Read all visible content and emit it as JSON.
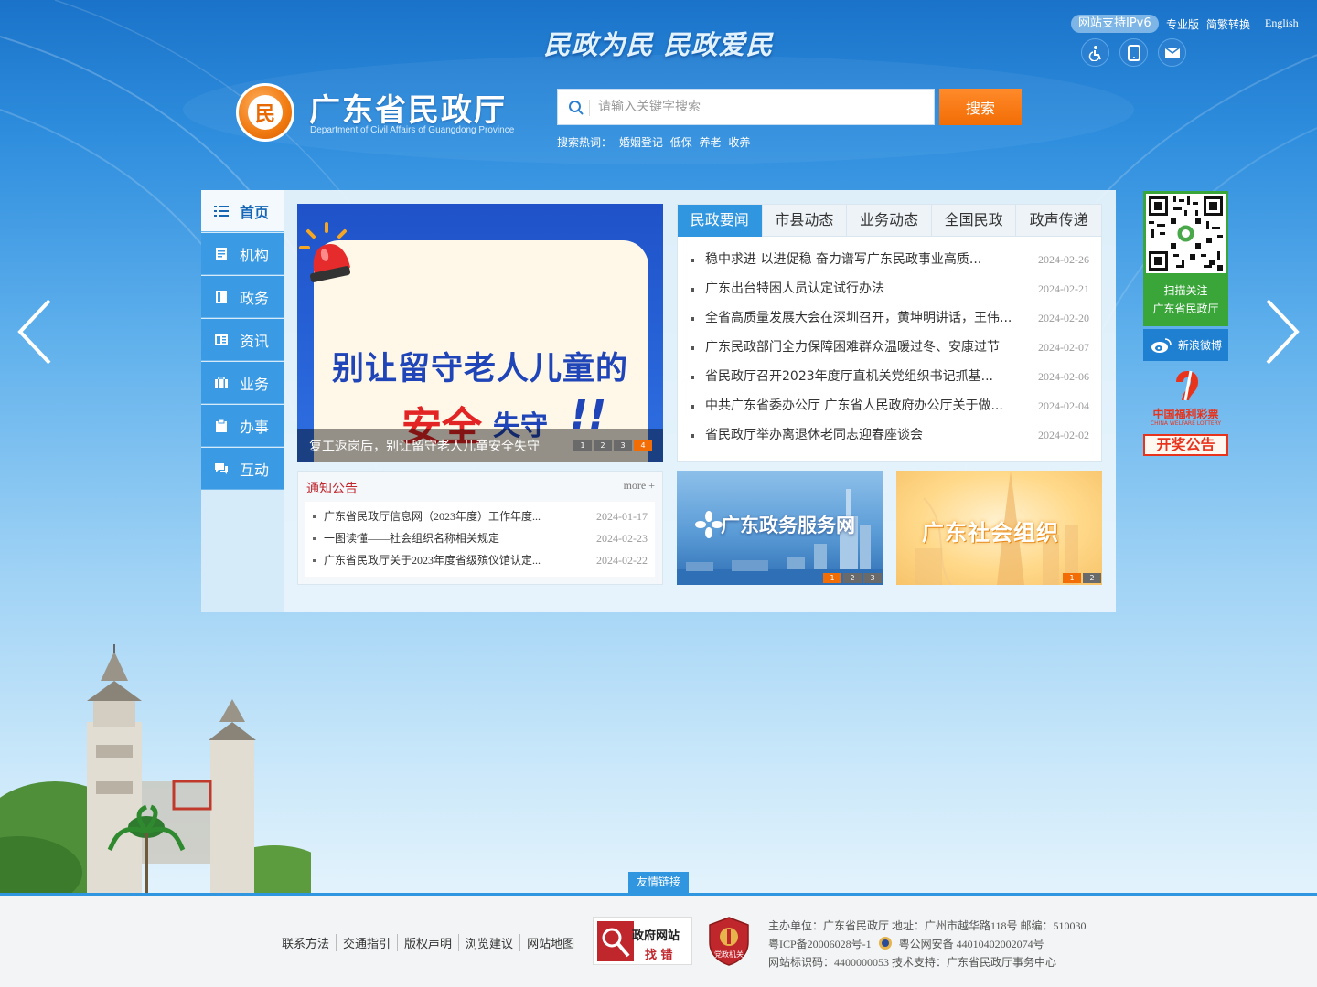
{
  "top": {
    "slogan": "民政为民 民政爱民",
    "ipv6": "网站支持IPv6",
    "links": [
      "专业版",
      "简繁转换",
      "English"
    ],
    "icons": [
      "accessibility-icon",
      "mobile-icon",
      "mail-icon"
    ]
  },
  "brand": {
    "title": "广东省民政厅",
    "subtitle": "Department of Civil Affairs of Guangdong Province"
  },
  "search": {
    "placeholder": "请输入关键字搜索",
    "button": "搜索",
    "hot_label": "搜索热词：",
    "hot_words": [
      "婚姻登记",
      "低保",
      "养老",
      "收养"
    ]
  },
  "nav": {
    "items": [
      {
        "label": "首页",
        "icon": "list-icon",
        "active": true
      },
      {
        "label": "机构",
        "icon": "document-icon",
        "active": false
      },
      {
        "label": "政务",
        "icon": "book-icon",
        "active": false
      },
      {
        "label": "资讯",
        "icon": "news-icon",
        "active": false
      },
      {
        "label": "业务",
        "icon": "briefcase-icon",
        "active": false
      },
      {
        "label": "办事",
        "icon": "clipboard-icon",
        "active": false
      },
      {
        "label": "互动",
        "icon": "chat-icon",
        "active": false
      }
    ]
  },
  "banner": {
    "headline1": "别让留守老人儿童的",
    "headline2a": "安全",
    "headline2b": "失守",
    "headline2c": "!!",
    "caption": "复工返岗后，别让留守老人儿童安全失守",
    "pages": [
      "1",
      "2",
      "3",
      "4"
    ],
    "active_page": 4
  },
  "news": {
    "tabs": [
      "民政要闻",
      "市县动态",
      "业务动态",
      "全国民政",
      "政声传递"
    ],
    "active_tab": 0,
    "items": [
      {
        "title": "稳中求进 以进促稳 奋力谱写广东民政事业高质...",
        "date": "2024-02-26"
      },
      {
        "title": "广东出台特困人员认定试行办法",
        "date": "2024-02-21"
      },
      {
        "title": "全省高质量发展大会在深圳召开，黄坤明讲话，王伟...",
        "date": "2024-02-20"
      },
      {
        "title": "广东民政部门全力保障困难群众温暖过冬、安康过节",
        "date": "2024-02-07"
      },
      {
        "title": "省民政厅召开2023年度厅直机关党组织书记抓基...",
        "date": "2024-02-06"
      },
      {
        "title": "中共广东省委办公厅 广东省人民政府办公厅关于做...",
        "date": "2024-02-04"
      },
      {
        "title": "省民政厅举办离退休老同志迎春座谈会",
        "date": "2024-02-02"
      }
    ]
  },
  "notice": {
    "title": "通知公告",
    "more": "more +",
    "items": [
      {
        "title": "广东省民政厅信息网（2023年度）工作年度...",
        "date": "2024-01-17"
      },
      {
        "title": "一图读懂——社会组织名称相关规定",
        "date": "2024-02-23"
      },
      {
        "title": "广东省民政厅关于2023年度省级殡仪馆认定...",
        "date": "2024-02-22"
      }
    ]
  },
  "promo": {
    "service": {
      "label": "广东政务服务网",
      "pages": [
        "1",
        "2",
        "3"
      ]
    },
    "social": {
      "label": "广东社会组织",
      "pages": [
        "1",
        "2"
      ]
    }
  },
  "sidebar": {
    "qr_line1": "扫描关注",
    "qr_line2": "广东省民政厅",
    "weibo": "新浪微博",
    "lottery_name": "中国福利彩票",
    "lottery_en": "CHINA WELFARE LOTTERY",
    "lottery_notice": "开奖公告"
  },
  "footer": {
    "friend_links": "友情链接",
    "links": [
      "联系方法",
      "交通指引",
      "版权声明",
      "浏览建议",
      "网站地图"
    ],
    "gov_badge_line1": "政府网站",
    "gov_badge_line2": "找 错",
    "party_badge": "党政机关",
    "info_line1": "主办单位：广东省民政厅 地址：广州市越华路118号 邮编：510030",
    "info_line2a": "粤ICP备20006028号-1",
    "info_line2b": "粤公网安备 44010402002074号",
    "info_line3": "网站标识码：4400000053 技术支持：广东省民政厅事务中心"
  },
  "colors": {
    "accent": "#3196e0",
    "orange": "#f26d05",
    "qr_green": "#3aa63a",
    "notice_red": "#c0272d"
  }
}
